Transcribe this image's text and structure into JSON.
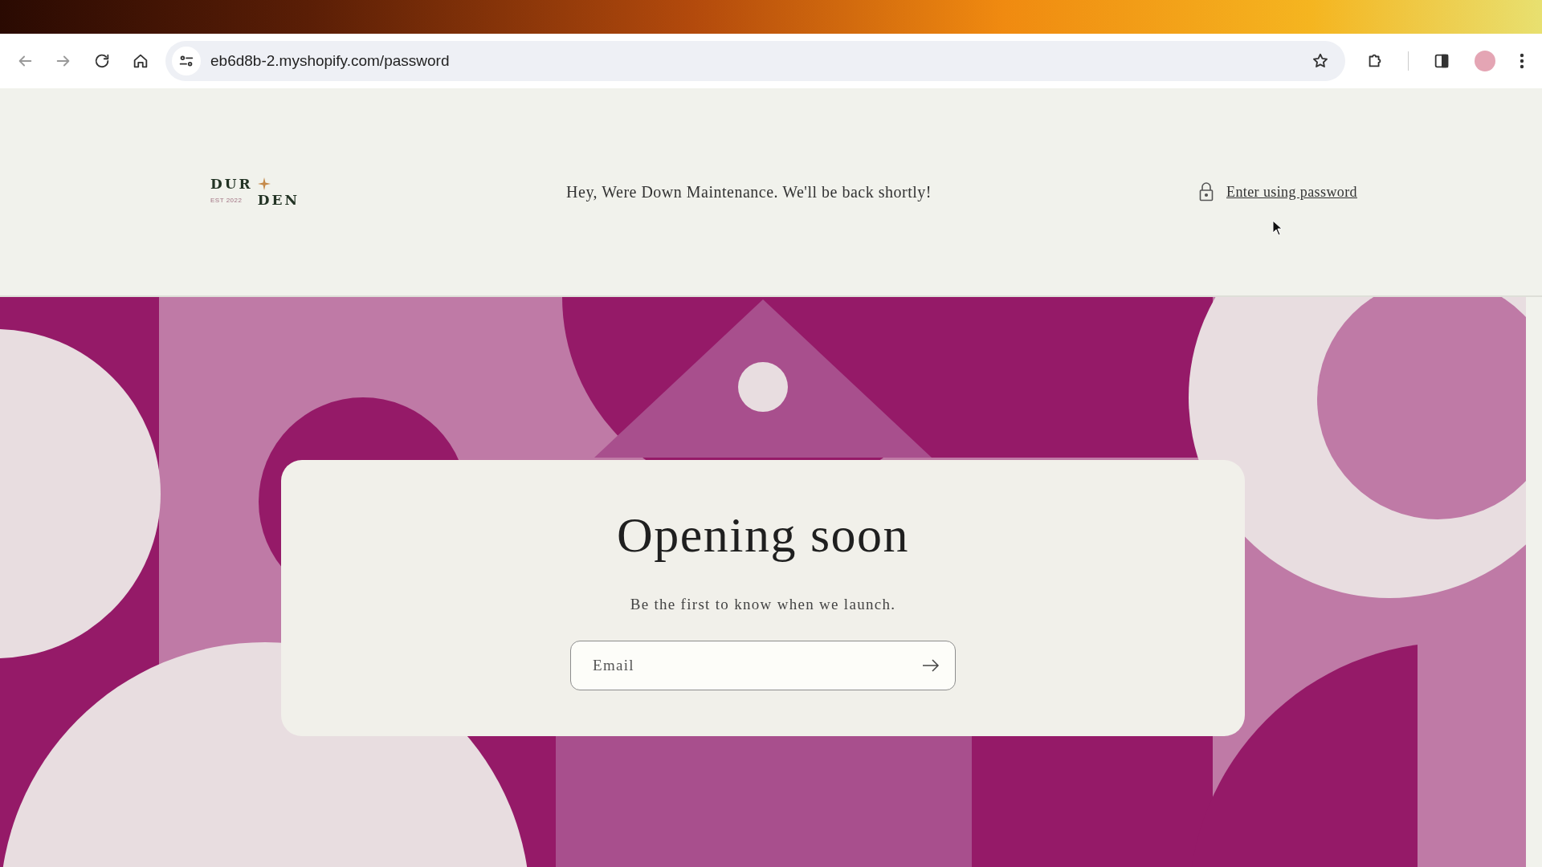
{
  "browser": {
    "url": "eb6d8b-2.myshopify.com/password"
  },
  "header": {
    "logo": {
      "top": "DUR",
      "bottom": "DEN",
      "tagline": "EST 2022"
    },
    "announcement": "Hey, Were Down Maintenance. We'll be back shortly!",
    "password_link": "Enter using password"
  },
  "card": {
    "title": "Opening soon",
    "subtitle": "Be the first to know when we launch.",
    "email": {
      "placeholder": "Email"
    }
  }
}
